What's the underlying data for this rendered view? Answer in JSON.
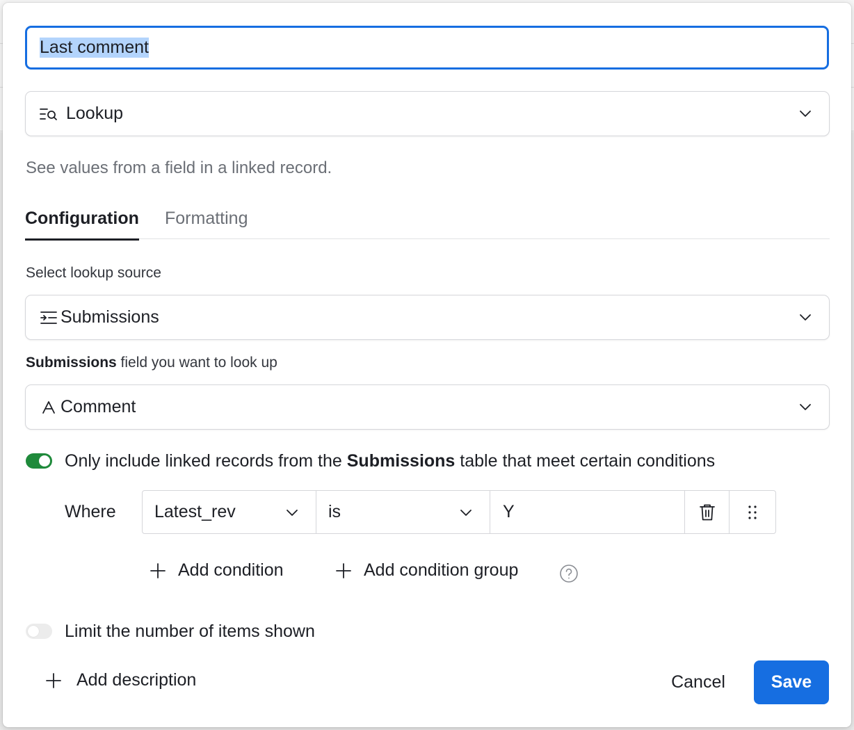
{
  "field": {
    "name_value": "Last comment"
  },
  "field_type": {
    "icon": "lookup-icon",
    "label": "Lookup",
    "description": "See values from a field in a linked record."
  },
  "tabs": [
    {
      "label": "Configuration",
      "active": true
    },
    {
      "label": "Formatting",
      "active": false
    }
  ],
  "lookup_source": {
    "label": "Select lookup source",
    "icon": "linked-record-icon",
    "value": "Submissions"
  },
  "lookup_field": {
    "label_bold": "Submissions",
    "label_rest": " field you want to look up",
    "icon": "text-field-icon",
    "value": "Comment"
  },
  "conditions_toggle": {
    "on": true,
    "text_before": "Only include linked records from the ",
    "text_bold": "Submissions",
    "text_after": " table that meet certain conditions"
  },
  "condition": {
    "where_label": "Where",
    "field": "Latest_rev",
    "operator": "is",
    "value": "Y"
  },
  "condition_actions": {
    "add_condition": "Add condition",
    "add_condition_group": "Add condition group"
  },
  "limit_toggle": {
    "on": false,
    "text": "Limit the number of items shown"
  },
  "footer": {
    "add_description": "Add description",
    "cancel": "Cancel",
    "save": "Save"
  },
  "colors": {
    "accent": "#166ee1",
    "toggle_on": "#1f8a3b"
  }
}
